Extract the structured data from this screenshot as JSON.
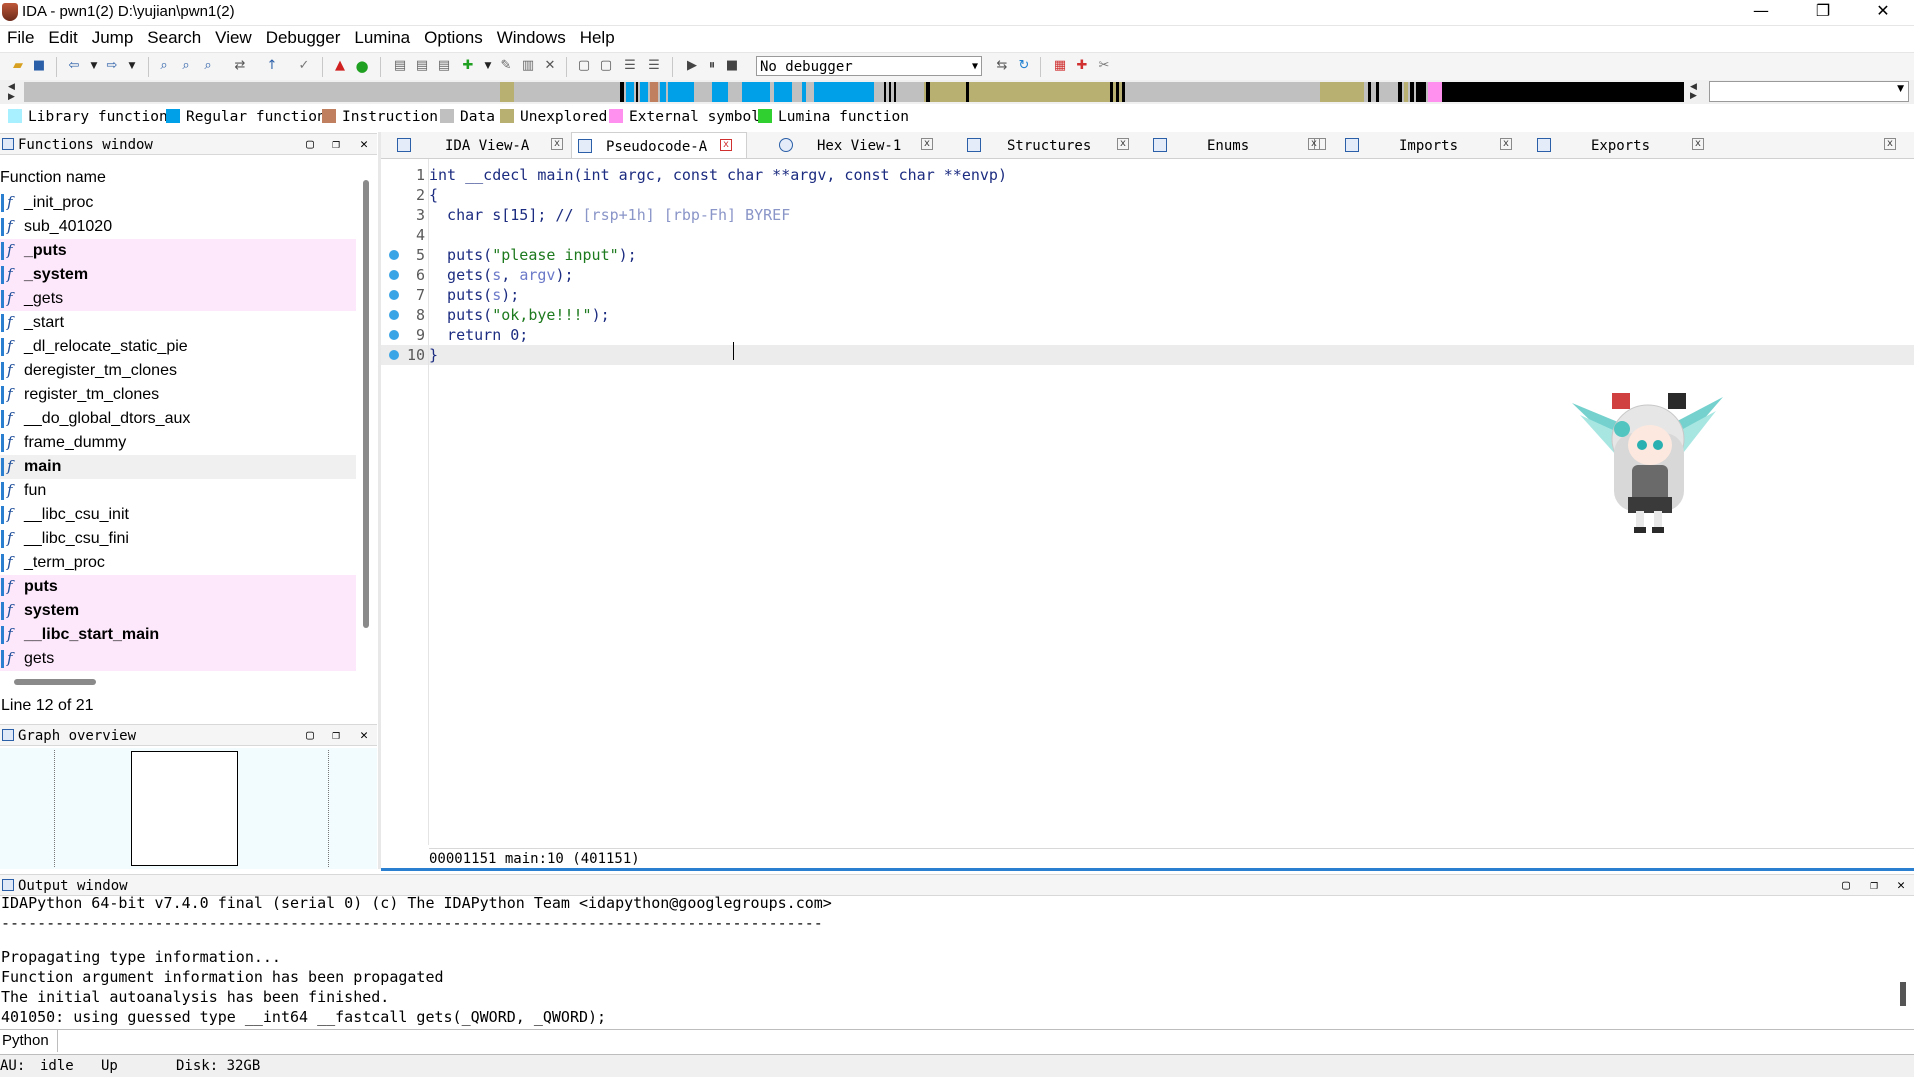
{
  "window": {
    "title": "IDA - pwn1(2) D:\\yujian\\pwn1(2)",
    "minimize": "—",
    "restore": "❐",
    "close": "✕"
  },
  "menu": [
    "File",
    "Edit",
    "Jump",
    "Search",
    "View",
    "Debugger",
    "Lumina",
    "Options",
    "Windows",
    "Help"
  ],
  "toolbar": {
    "debugger_value": "No debugger"
  },
  "legend": [
    {
      "label": "Library function",
      "color": "#a8f0ff"
    },
    {
      "label": "Regular function",
      "color": "#00a0e8"
    },
    {
      "label": "Instruction",
      "color": "#c08060"
    },
    {
      "label": "Data",
      "color": "#c0c0c0"
    },
    {
      "label": "Unexplored",
      "color": "#b8b070"
    },
    {
      "label": "External symbol",
      "color": "#ff90f0"
    },
    {
      "label": "Lumina function",
      "color": "#30d030"
    }
  ],
  "functions_window": {
    "title": "Functions window",
    "column": "Function name",
    "items": [
      {
        "name": "_init_proc",
        "kind": "normal"
      },
      {
        "name": "sub_401020",
        "kind": "normal"
      },
      {
        "name": "_puts",
        "kind": "ext-bold"
      },
      {
        "name": "_system",
        "kind": "ext-bold"
      },
      {
        "name": "_gets",
        "kind": "ext"
      },
      {
        "name": "_start",
        "kind": "normal"
      },
      {
        "name": "_dl_relocate_static_pie",
        "kind": "normal"
      },
      {
        "name": "deregister_tm_clones",
        "kind": "normal"
      },
      {
        "name": "register_tm_clones",
        "kind": "normal"
      },
      {
        "name": "__do_global_dtors_aux",
        "kind": "normal"
      },
      {
        "name": "frame_dummy",
        "kind": "normal"
      },
      {
        "name": "main",
        "kind": "sel-bold"
      },
      {
        "name": "fun",
        "kind": "normal"
      },
      {
        "name": "__libc_csu_init",
        "kind": "normal"
      },
      {
        "name": "__libc_csu_fini",
        "kind": "normal"
      },
      {
        "name": "_term_proc",
        "kind": "normal"
      },
      {
        "name": "puts",
        "kind": "ext-bold"
      },
      {
        "name": "system",
        "kind": "ext-bold"
      },
      {
        "name": "__libc_start_main",
        "kind": "ext-bold"
      },
      {
        "name": "gets",
        "kind": "ext"
      }
    ],
    "status": "Line 12 of 21"
  },
  "graph_overview": {
    "title": "Graph overview"
  },
  "tabs": [
    "IDA View-A",
    "Pseudocode-A",
    "Hex View-1",
    "Structures",
    "Enums",
    "Imports",
    "Exports"
  ],
  "code": {
    "lines": [
      {
        "n": "1",
        "bp": false,
        "parts": [
          [
            "int __cdecl main(int argc, const char **argv, const char **envp)",
            ""
          ]
        ]
      },
      {
        "n": "2",
        "bp": false,
        "parts": [
          [
            "{",
            ""
          ]
        ]
      },
      {
        "n": "3",
        "bp": false,
        "parts": [
          [
            "  char s[15]; // ",
            ""
          ],
          [
            "[rsp+1h] [rbp-Fh] BYREF",
            "cm"
          ]
        ]
      },
      {
        "n": "4",
        "bp": false,
        "parts": [
          [
            "",
            ""
          ]
        ]
      },
      {
        "n": "5",
        "bp": true,
        "parts": [
          [
            "  puts(",
            ""
          ],
          [
            "\"please input\"",
            "str"
          ],
          [
            ");",
            ""
          ]
        ]
      },
      {
        "n": "6",
        "bp": true,
        "parts": [
          [
            "  gets(",
            ""
          ],
          [
            "s",
            "var"
          ],
          [
            ", ",
            ""
          ],
          [
            "argv",
            "var"
          ],
          [
            ");",
            ""
          ]
        ]
      },
      {
        "n": "7",
        "bp": true,
        "parts": [
          [
            "  puts(",
            ""
          ],
          [
            "s",
            "var"
          ],
          [
            ");",
            ""
          ]
        ]
      },
      {
        "n": "8",
        "bp": true,
        "parts": [
          [
            "  puts(",
            ""
          ],
          [
            "\"ok,bye!!!\"",
            "str"
          ],
          [
            ");",
            ""
          ]
        ]
      },
      {
        "n": "9",
        "bp": true,
        "parts": [
          [
            "  return 0;",
            ""
          ]
        ]
      },
      {
        "n": "10",
        "bp": true,
        "parts": [
          [
            "}",
            ""
          ]
        ]
      }
    ],
    "status": "00001151 main:10 (401151)"
  },
  "output": {
    "title": "Output window",
    "lines": [
      "IDAPython 64-bit v7.4.0 final (serial 0) (c) The IDAPython Team <idapython@googlegroups.com>",
      "-------------------------------------------------------------------------------------------",
      "Propagating type information...",
      "Function argument information has been propagated",
      "The initial autoanalysis has been finished.",
      "401050: using guessed type __int64 __fastcall gets(_QWORD, _QWORD);"
    ],
    "lang": "Python"
  },
  "statusbar": {
    "au_label": "AU:",
    "au_value": "idle",
    "direction": "Up",
    "disk": "Disk: 32GB"
  }
}
